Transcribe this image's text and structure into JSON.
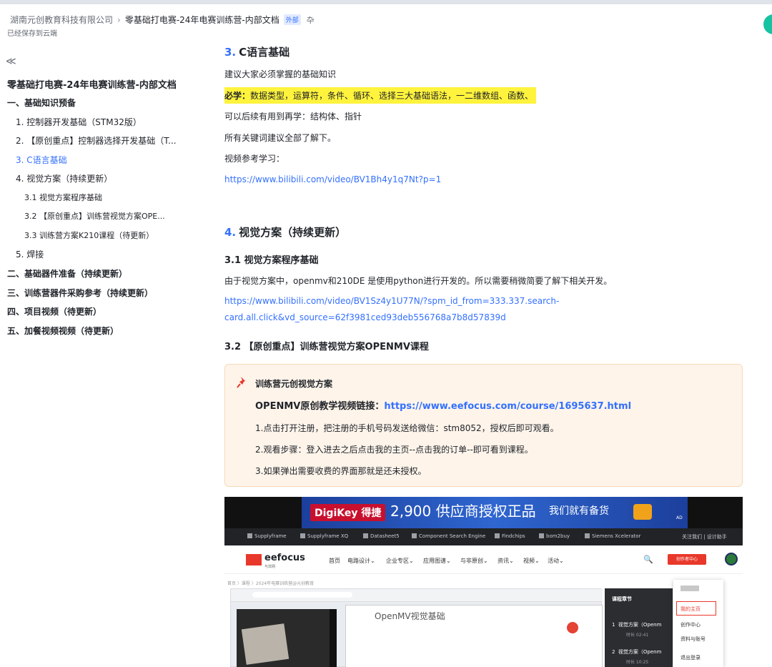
{
  "header": {
    "org": "湖南元创教育科技有限公司",
    "separator": "›",
    "doc_title": "零基础打电赛-24年电赛训练营-内部文档",
    "tag": "外部",
    "pin": "卆",
    "saved": "已经保存到云端"
  },
  "sidebar": {
    "collapse": "≪",
    "title": "零基础打电赛-24年电赛训练营-内部文档",
    "items": [
      {
        "label": "一、基础知识预备"
      },
      {
        "label": "1. 控制器开发基础（STM32版）"
      },
      {
        "label": "2. 【原创重点】控制器选择开发基础（T..."
      },
      {
        "label": "3. C语言基础"
      },
      {
        "label": "4. 视觉方案（持续更新）"
      },
      {
        "label": "3.1 视觉方案程序基础"
      },
      {
        "label": "3.2 【原创重点】训练营视觉方案OPE..."
      },
      {
        "label": "3.3 训练营方案K210课程（待更新）"
      },
      {
        "label": "5. 焊接"
      },
      {
        "label": "二、基础器件准备（持续更新）"
      },
      {
        "label": "三、训练营器件采购参考（持续更新）"
      },
      {
        "label": "四、项目视频（待更新）"
      },
      {
        "label": "五、加餐视频视频（待更新）"
      }
    ]
  },
  "content": {
    "sec3_num": "3.",
    "sec3_title": "C语言基础",
    "p1": "建议大家必须掌握的基础知识",
    "must_label": "必学：",
    "must_text": "数据类型，运算符，条件、循环、选择三大基础语法，一二维数组、函数、",
    "p2": "可以后续有用到再学：结构体、指针",
    "p3": "所有关键词建议全部了解下。",
    "p4": "视频参考学习：",
    "link1": "https://www.bilibili.com/video/BV1Bh4y1q7Nt?p=1",
    "sec4_num": "4.",
    "sec4_title": "视觉方案（持续更新）",
    "h31": "3.1 视觉方案程序基础",
    "p5": "由于视觉方案中，openmv和210DE 是使用python进行开发的。所以需要稍微简要了解下相关开发。",
    "link2a": "https://www.bilibili.com/video/BV1Sz4y1U77N/?spm_id_from=333.337.search-",
    "link2b": "card.all.click&vd_source=62f3981ced93deb556768a7b8d57839d",
    "h32": "3.2 【原创重点】训练营视觉方案OPENMV课程"
  },
  "callout": {
    "title": "训练营元创视觉方案",
    "bold_label": "OPENMV原创教学视频链接：",
    "bold_link": "https://www.eefocus.com/course/1695637.html",
    "line1": "1.点击打开注册，把注册的手机号码发送给微信：stm8052，授权后即可观看。",
    "line2": "2.观看步骤：登入进去之后点击我的主页--点击我的订单--即可看到课程。",
    "line3": "3.如果弹出需要收费的界面那就是还未授权。"
  },
  "screenshot": {
    "ad_brand": "DigiKey 得捷",
    "ad_big": "2,900 供应商授权正品",
    "ad_small": "我们就有备货",
    "ad_tag": "AD",
    "toolbar": [
      "Supplyframe",
      "Supplyframe XQ",
      "Datasheet5",
      "Component Search Engine",
      "Findchips",
      "bom2buy",
      "Siemens Xcelerator",
      "关注我们 | 设计助手"
    ],
    "logo": "eefocus",
    "logo_sub": "与非网",
    "nav": [
      "首页",
      "电路设计⌄",
      "企业专区⌄",
      "应用图谱⌄",
      "与非原创⌄",
      "资讯⌄",
      "视频⌄",
      "活动⌄"
    ],
    "search": "🔍",
    "create": "创作者中心",
    "crumb": "首页 〉课程 〉2024年电赛训练营@元创教育",
    "inner_title": "OpenMV视觉基础",
    "panel_title": "课程章节",
    "panel_rows": [
      {
        "n": "1",
        "title": "视觉方案（Openm",
        "time": "时长 02:41"
      },
      {
        "n": "2",
        "title": "视觉方案（Openm",
        "time": "时长 10:25"
      }
    ],
    "menu": [
      "我的主页",
      "创作中心",
      "资料与账号",
      "退出登录"
    ]
  }
}
